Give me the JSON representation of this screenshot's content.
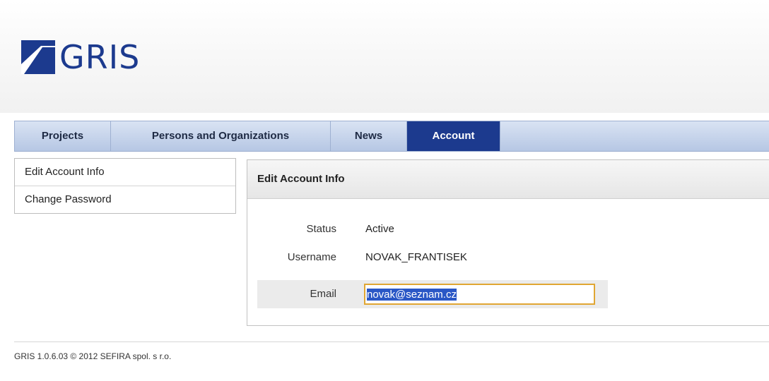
{
  "app": {
    "logo_text": "GRIS"
  },
  "nav": {
    "tabs": [
      {
        "label": "Projects"
      },
      {
        "label": "Persons and Organizations"
      },
      {
        "label": "News"
      },
      {
        "label": "Account"
      }
    ]
  },
  "sidebar": {
    "items": [
      {
        "label": "Edit Account Info"
      },
      {
        "label": "Change Password"
      }
    ]
  },
  "panel": {
    "title": "Edit Account Info",
    "fields": {
      "status": {
        "label": "Status",
        "value": "Active"
      },
      "username": {
        "label": "Username",
        "value": "NOVAK_FRANTISEK"
      },
      "email": {
        "label": "Email",
        "value": "novak@seznam.cz"
      }
    }
  },
  "footer": {
    "text": "GRIS 1.0.6.03 © 2012 SEFIRA spol. s r.o."
  },
  "colors": {
    "brand": "#1c3a8e",
    "active_tab": "#1c3a8e",
    "focus_border": "#e0a633",
    "selection": "#2a57c6"
  }
}
